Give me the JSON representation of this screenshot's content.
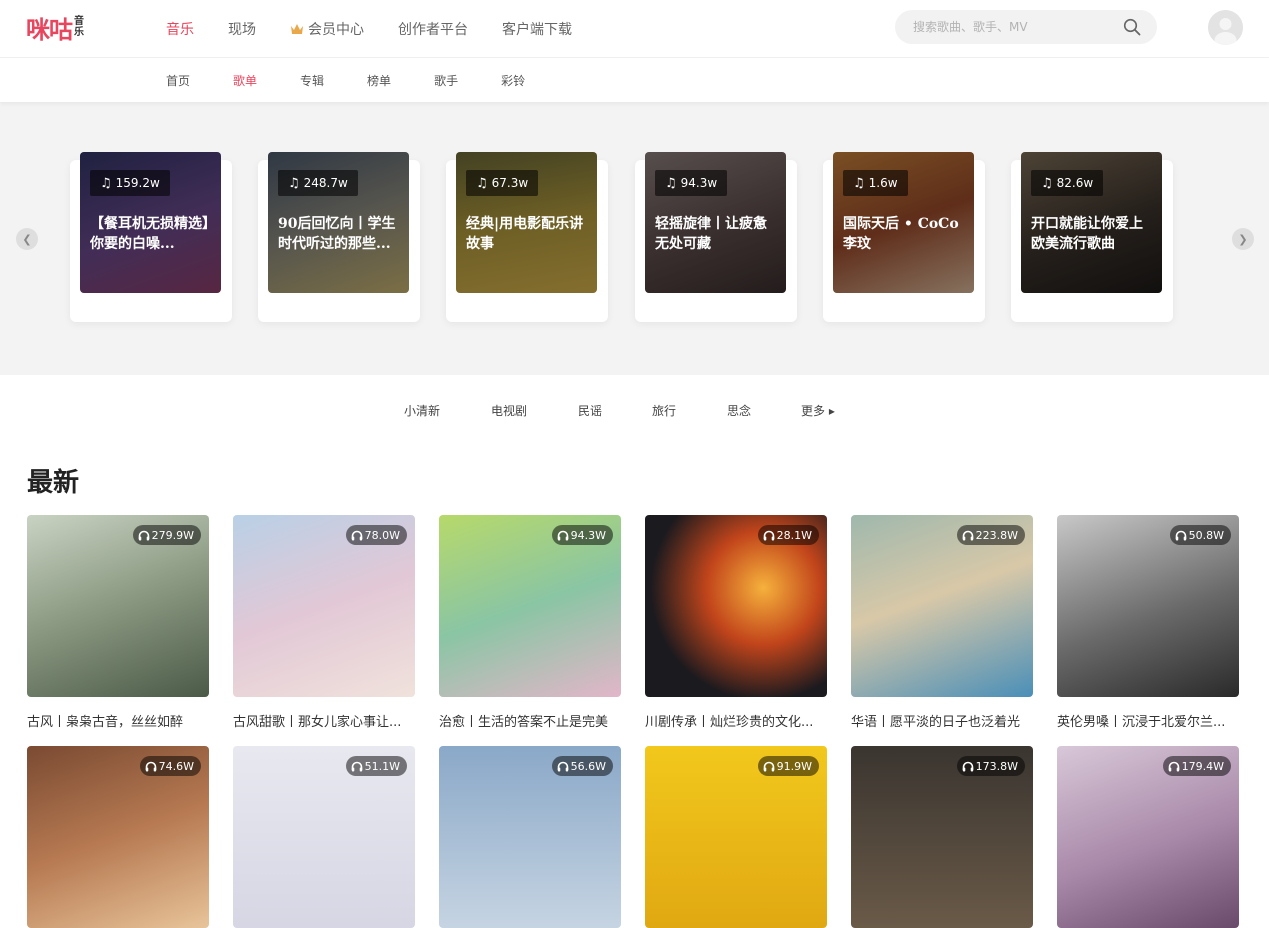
{
  "header": {
    "logo_text": "咪咕",
    "logo_sub": "音乐",
    "nav": [
      {
        "label": "音乐",
        "active": true
      },
      {
        "label": "现场",
        "active": false
      },
      {
        "label": "会员中心",
        "active": false,
        "icon": "crown-icon"
      },
      {
        "label": "创作者平台",
        "active": false
      },
      {
        "label": "客户端下载",
        "active": false
      }
    ],
    "search_placeholder": "搜索歌曲、歌手、MV",
    "accent_color": "#e8465e"
  },
  "subnav": [
    {
      "label": "首页",
      "active": false
    },
    {
      "label": "歌单",
      "active": true
    },
    {
      "label": "专辑",
      "active": false
    },
    {
      "label": "榜单",
      "active": false
    },
    {
      "label": "歌手",
      "active": false
    },
    {
      "label": "彩铃",
      "active": false
    }
  ],
  "carousel": [
    {
      "count": "159.2w",
      "title": "【餐耳机无损精选】你要的白噪..."
    },
    {
      "count": "248.7w",
      "title": "90后回忆向丨学生时代听过的那些..."
    },
    {
      "count": "67.3w",
      "title": "经典|用电影配乐讲故事"
    },
    {
      "count": "94.3w",
      "title": "轻摇旋律丨让疲惫无处可藏"
    },
    {
      "count": "1.6w",
      "title": "国际天后 • CoCo李玟"
    },
    {
      "count": "82.6w",
      "title": "开口就能让你爱上欧美流行歌曲"
    }
  ],
  "tags": [
    "小清新",
    "电视剧",
    "民谣",
    "旅行",
    "思念",
    "更多 ▸"
  ],
  "section_title": "最新",
  "playlists": [
    {
      "count": "279.9W",
      "name": "古风丨枭枭古音，丝丝如醉"
    },
    {
      "count": "78.0W",
      "name": "古风甜歌丨那女儿家心事让..."
    },
    {
      "count": "94.3W",
      "name": "治愈丨生活的答案不止是完美"
    },
    {
      "count": "28.1W",
      "name": "川剧传承丨灿烂珍贵的文化..."
    },
    {
      "count": "223.8W",
      "name": "华语丨愿平淡的日子也泛着光"
    },
    {
      "count": "50.8W",
      "name": "英伦男嗓丨沉浸于北爱尔兰..."
    },
    {
      "count": "74.6W",
      "name": ""
    },
    {
      "count": "51.1W",
      "name": ""
    },
    {
      "count": "56.6W",
      "name": ""
    },
    {
      "count": "91.9W",
      "name": ""
    },
    {
      "count": "173.8W",
      "name": ""
    },
    {
      "count": "179.4W",
      "name": ""
    }
  ]
}
